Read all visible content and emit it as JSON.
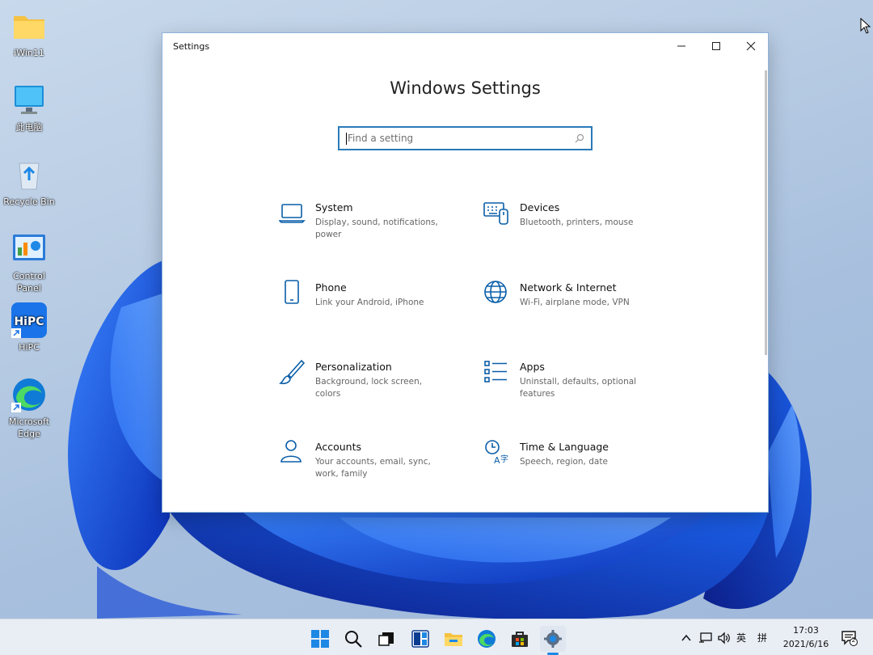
{
  "desktop": {
    "icons": [
      {
        "label": "iWin11",
        "icon": "folder-icon"
      },
      {
        "label": "此电脑",
        "icon": "this-pc-icon"
      },
      {
        "label": "Recycle Bin",
        "icon": "recycle-bin-icon"
      },
      {
        "label": "Control Panel",
        "icon": "control-panel-icon"
      },
      {
        "label": "HiPC",
        "icon": "hipc-icon"
      },
      {
        "label": "Microsoft Edge",
        "icon": "edge-icon"
      }
    ]
  },
  "window": {
    "title": "Settings",
    "heading": "Windows Settings",
    "search_placeholder": "Find a setting",
    "tiles": [
      {
        "name": "System",
        "desc": "Display, sound, notifications, power",
        "icon": "laptop-icon"
      },
      {
        "name": "Devices",
        "desc": "Bluetooth, printers, mouse",
        "icon": "devices-icon"
      },
      {
        "name": "Phone",
        "desc": "Link your Android, iPhone",
        "icon": "phone-icon"
      },
      {
        "name": "Network & Internet",
        "desc": "Wi-Fi, airplane mode, VPN",
        "icon": "globe-icon"
      },
      {
        "name": "Personalization",
        "desc": "Background, lock screen, colors",
        "icon": "brush-icon"
      },
      {
        "name": "Apps",
        "desc": "Uninstall, defaults, optional features",
        "icon": "apps-list-icon"
      },
      {
        "name": "Accounts",
        "desc": "Your accounts, email, sync, work, family",
        "icon": "person-icon"
      },
      {
        "name": "Time & Language",
        "desc": "Speech, region, date",
        "icon": "time-language-icon"
      }
    ]
  },
  "colors": {
    "accent": "#0a5ea8",
    "search_border": "#2a7ab8"
  },
  "taskbar": {
    "apps": [
      "start-icon",
      "search-icon",
      "task-view-icon",
      "widgets-icon",
      "file-explorer-icon",
      "edge-icon",
      "store-icon",
      "settings-icon"
    ],
    "tray": {
      "ime_lang": "英",
      "ime_mode": "拼"
    },
    "clock": {
      "time": "17:03",
      "date": "2021/6/16"
    },
    "notification_count": "2"
  }
}
